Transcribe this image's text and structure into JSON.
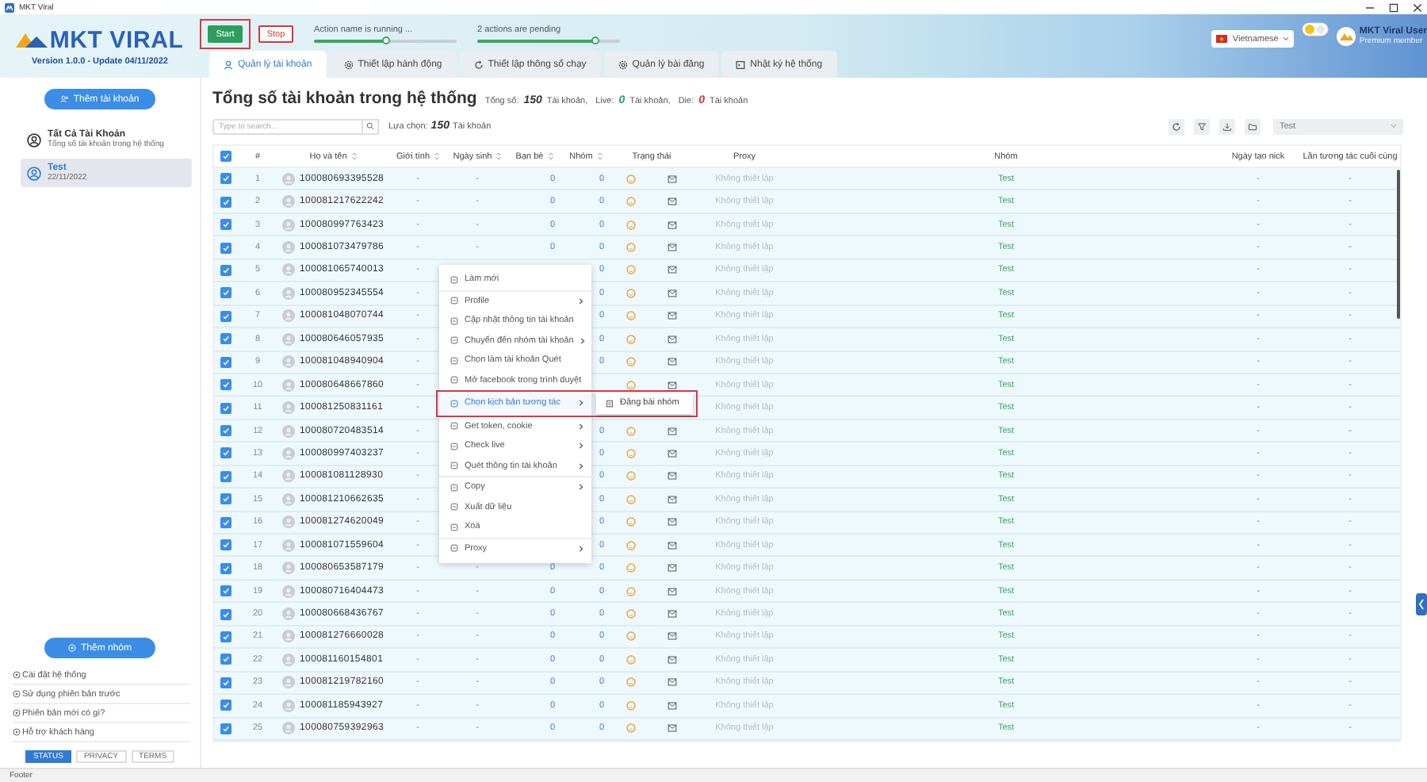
{
  "window": {
    "title": "MKT Viral"
  },
  "header": {
    "logo": "MKT VIRAL",
    "version": "Version 1.0.0 - Update 04/11/2022",
    "buttons": [
      {
        "label": "Start",
        "kind": "start",
        "highlighted": true
      },
      {
        "label": "Stop",
        "kind": "stop",
        "highlighted": false
      }
    ],
    "progress": [
      {
        "label": "Action name is running ...",
        "level": 0.5
      },
      {
        "label": "2 actions are pending",
        "level": 0.83
      }
    ],
    "language": "Vietnamese",
    "user": {
      "name": "MKT Viral User",
      "plan": "Premium member"
    }
  },
  "tabs": [
    {
      "label": "Quản lý tài khoản",
      "selected": true
    },
    {
      "label": "Thiết lập hành động",
      "selected": false
    },
    {
      "label": "Thiết lập thông số chạy",
      "selected": false
    },
    {
      "label": "Quản lý bài đăng",
      "selected": false
    },
    {
      "label": "Nhật ký hệ thống",
      "selected": false
    }
  ],
  "sidebar": {
    "add_account": "Thêm tài khoản",
    "groups": [
      {
        "name": "Tất Cả Tài Khoản",
        "subtitle": "Tổng số tài khoản trong hệ thống",
        "selected": false
      },
      {
        "name": "Test",
        "subtitle": "22/11/2022",
        "selected": true
      }
    ],
    "add_group": "Thêm nhóm",
    "links": [
      "Cài đặt hệ thống",
      "Sử dụng phiên bản trước",
      "Phiên bản mới có gì?",
      "Hỗ trợ khách hàng"
    ],
    "footer_tabs": [
      {
        "label": "STATUS",
        "selected": true
      },
      {
        "label": "PRIVACY",
        "selected": false
      },
      {
        "label": "TERMS",
        "selected": false
      }
    ]
  },
  "main": {
    "title": "Tổng số tài khoản trong hệ thống",
    "stats": [
      {
        "label": "Tổng số:",
        "value": "150",
        "unit": "Tài khoản,",
        "kind": "total"
      },
      {
        "label": "Live:",
        "value": "0",
        "unit": "Tài khoản,",
        "kind": "live"
      },
      {
        "label": "Die:",
        "value": "0",
        "unit": "Tài khoản",
        "kind": "die"
      }
    ],
    "search": {
      "placeholder": "Type to search..."
    },
    "selection": {
      "label": "Lựa chọn:",
      "value": "150",
      "unit": "Tài khoản"
    },
    "group_filter": "Test"
  },
  "table": {
    "all_checked": true,
    "columns": [
      {
        "label": "#",
        "sortable": false
      },
      {
        "label": "Họ và tên",
        "sortable": true
      },
      {
        "label": "Giới tính",
        "sortable": true
      },
      {
        "label": "Ngày sinh",
        "sortable": true
      },
      {
        "label": "Bạn bè",
        "sortable": true
      },
      {
        "label": "Nhóm",
        "sortable": true
      },
      {
        "label": "Trạng thái",
        "sortable": false
      },
      {
        "label": "Proxy",
        "sortable": false
      },
      {
        "label": "Nhóm",
        "sortable": false
      },
      {
        "label": "Ngày tạo nick",
        "sortable": false
      },
      {
        "label": "Lần tương tác cuối cùng",
        "sortable": false
      }
    ],
    "rows": [
      {
        "index": "1",
        "checked": true,
        "name": "100080693395528",
        "gender": "-",
        "birthday": "-",
        "friends": "0",
        "groups": "0",
        "proxy": "Không thiết lập",
        "group": "Test",
        "created": "-",
        "last_interaction": "-"
      },
      {
        "index": "2",
        "checked": true,
        "name": "100081217622242",
        "gender": "-",
        "birthday": "-",
        "friends": "0",
        "groups": "0",
        "proxy": "Không thiết lập",
        "group": "Test",
        "created": "-",
        "last_interaction": "-"
      },
      {
        "index": "3",
        "checked": true,
        "name": "100080997763423",
        "gender": "-",
        "birthday": "-",
        "friends": "0",
        "groups": "0",
        "proxy": "Không thiết lập",
        "group": "Test",
        "created": "-",
        "last_interaction": "-"
      },
      {
        "index": "4",
        "checked": true,
        "name": "100081073479786",
        "gender": "-",
        "birthday": "-",
        "friends": "0",
        "groups": "0",
        "proxy": "Không thiết lập",
        "group": "Test",
        "created": "-",
        "last_interaction": "-"
      },
      {
        "index": "5",
        "checked": true,
        "name": "100081065740013",
        "gender": "-",
        "groups": "0",
        "proxy": "Không thiết lập",
        "group": "Test",
        "created": "-",
        "last_interaction": "-"
      },
      {
        "index": "6",
        "checked": true,
        "name": "100080952345554",
        "gender": "-",
        "groups": "0",
        "proxy": "Không thiết lập",
        "group": "Test",
        "created": "-",
        "last_interaction": "-"
      },
      {
        "index": "7",
        "checked": true,
        "name": "100081048070744",
        "gender": "-",
        "groups": "0",
        "proxy": "Không thiết lập",
        "group": "Test",
        "created": "-",
        "last_interaction": "-"
      },
      {
        "index": "8",
        "checked": true,
        "name": "100080646057935",
        "gender": "-",
        "groups": "0",
        "proxy": "Không thiết lập",
        "group": "Test",
        "created": "-",
        "last_interaction": "-"
      },
      {
        "index": "9",
        "checked": true,
        "name": "100081048940904",
        "gender": "-",
        "groups": "0",
        "proxy": "Không thiết lập",
        "group": "Test",
        "created": "-",
        "last_interaction": "-"
      },
      {
        "index": "10",
        "checked": true,
        "name": "100080648667860",
        "gender": "-",
        "proxy": "Không thiết lập",
        "group": "Test",
        "created": "-",
        "last_interaction": "-"
      },
      {
        "index": "11",
        "checked": true,
        "name": "100081250831161",
        "gender": "-",
        "proxy": "Không thiết lập",
        "group": "Test",
        "created": "-",
        "last_interaction": "-"
      },
      {
        "index": "12",
        "checked": true,
        "name": "100080720483514",
        "gender": "-",
        "groups": "0",
        "proxy": "Không thiết lập",
        "group": "Test",
        "created": "-",
        "last_interaction": "-"
      },
      {
        "index": "13",
        "checked": true,
        "name": "100080997403237",
        "gender": "-",
        "groups": "0",
        "proxy": "Không thiết lập",
        "group": "Test",
        "created": "-",
        "last_interaction": "-"
      },
      {
        "index": "14",
        "checked": true,
        "name": "100081081128930",
        "gender": "-",
        "groups": "0",
        "proxy": "Không thiết lập",
        "group": "Test",
        "created": "-",
        "last_interaction": "-"
      },
      {
        "index": "15",
        "checked": true,
        "name": "100081210662635",
        "gender": "-",
        "groups": "0",
        "proxy": "Không thiết lập",
        "group": "Test",
        "created": "-",
        "last_interaction": "-"
      },
      {
        "index": "16",
        "checked": true,
        "name": "100081274620049",
        "gender": "-",
        "groups": "0",
        "proxy": "Không thiết lập",
        "group": "Test",
        "created": "-",
        "last_interaction": "-"
      },
      {
        "index": "17",
        "checked": true,
        "name": "100081071559604",
        "gender": "-",
        "groups": "0",
        "proxy": "Không thiết lập",
        "group": "Test",
        "created": "-",
        "last_interaction": "-"
      },
      {
        "index": "18",
        "checked": true,
        "name": "100080653587179",
        "gender": "-",
        "birthday": "-",
        "friends": "0",
        "groups": "0",
        "proxy": "Không thiết lập",
        "group": "Test",
        "created": "-",
        "last_interaction": "-"
      },
      {
        "index": "19",
        "checked": true,
        "name": "100080716404473",
        "gender": "-",
        "birthday": "-",
        "friends": "0",
        "groups": "0",
        "proxy": "Không thiết lập",
        "group": "Test",
        "created": "-",
        "last_interaction": "-"
      },
      {
        "index": "20",
        "checked": true,
        "name": "100080668436767",
        "gender": "-",
        "birthday": "-",
        "friends": "0",
        "groups": "0",
        "proxy": "Không thiết lập",
        "group": "Test",
        "created": "-",
        "last_interaction": "-"
      },
      {
        "index": "21",
        "checked": true,
        "name": "100081276660028",
        "gender": "-",
        "birthday": "-",
        "friends": "0",
        "groups": "0",
        "proxy": "Không thiết lập",
        "group": "Test",
        "created": "-",
        "last_interaction": "-"
      },
      {
        "index": "22",
        "checked": true,
        "name": "100081160154801",
        "gender": "-",
        "birthday": "-",
        "friends": "0",
        "groups": "0",
        "proxy": "Không thiết lập",
        "group": "Test",
        "created": "-",
        "last_interaction": "-"
      },
      {
        "index": "23",
        "checked": true,
        "name": "100081219782160",
        "gender": "-",
        "birthday": "-",
        "friends": "0",
        "groups": "0",
        "proxy": "Không thiết lập",
        "group": "Test",
        "created": "-",
        "last_interaction": "-"
      },
      {
        "index": "24",
        "checked": true,
        "name": "100081185943927",
        "gender": "-",
        "birthday": "-",
        "friends": "0",
        "groups": "0",
        "proxy": "Không thiết lập",
        "group": "Test",
        "created": "-",
        "last_interaction": "-"
      },
      {
        "index": "25",
        "checked": true,
        "name": "100080759392963",
        "gender": "-",
        "birthday": "-",
        "friends": "0",
        "groups": "0",
        "proxy": "Không thiết lập",
        "group": "Test",
        "created": "-",
        "last_interaction": "-"
      }
    ]
  },
  "context_menu": {
    "groups": [
      [
        {
          "label": "Làm mới",
          "submenu": false,
          "selected": false
        }
      ],
      [
        {
          "label": "Profile",
          "submenu": true,
          "selected": false
        },
        {
          "label": "Cập nhật thông tin tài khoản",
          "submenu": false,
          "selected": false
        },
        {
          "label": "Chuyển đến nhóm tài khoản",
          "submenu": true,
          "selected": false
        },
        {
          "label": "Chọn làm tài khoản Quét",
          "submenu": false,
          "selected": false
        },
        {
          "label": "Mở facebook trong trình duyệt",
          "submenu": false,
          "selected": false
        },
        {
          "label": "Chọn kịch bản tương tác",
          "submenu": true,
          "selected": true
        },
        {
          "label": "Get token, cookie",
          "submenu": true,
          "selected": false
        },
        {
          "label": "Check live",
          "submenu": true,
          "selected": false
        },
        {
          "label": "Quét thông tin tài khoản",
          "submenu": true,
          "selected": false
        }
      ],
      [
        {
          "label": "Copy",
          "submenu": true,
          "selected": false
        },
        {
          "label": "Xuất dữ liệu",
          "submenu": false,
          "selected": false
        },
        {
          "label": "Xoá",
          "submenu": false,
          "selected": false
        }
      ],
      [
        {
          "label": "Proxy",
          "submenu": true,
          "selected": false
        }
      ]
    ],
    "submenu": [
      {
        "label": "Đăng bài nhóm"
      }
    ]
  },
  "footer": "Footer"
}
